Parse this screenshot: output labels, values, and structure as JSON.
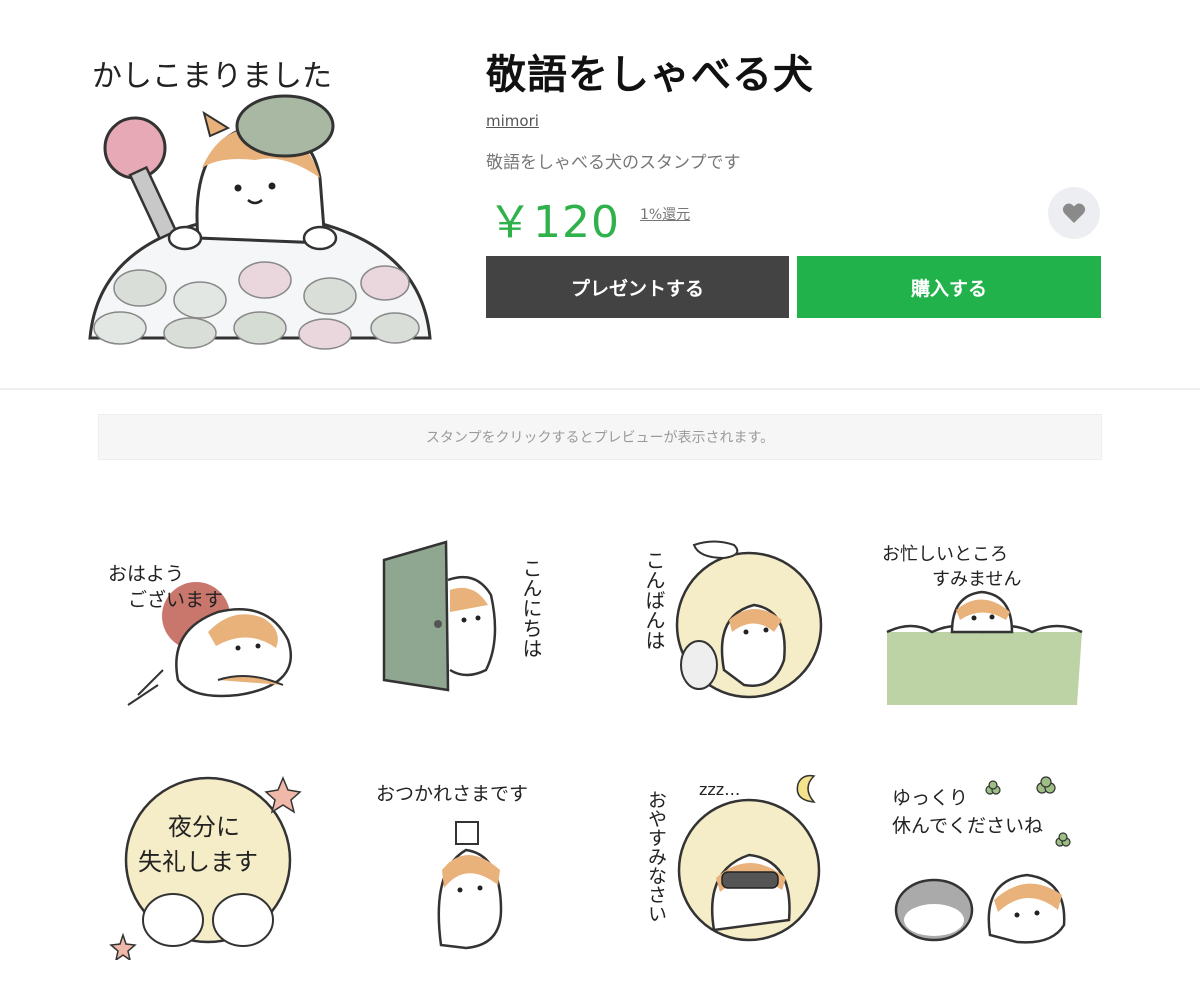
{
  "product": {
    "title": "敬語をしゃべる犬",
    "author": "mimori",
    "description": "敬語をしゃべる犬のスタンプです",
    "price": "￥120",
    "cashback": "1%還元",
    "favorite_icon": "heart-icon",
    "main_sticker_text": "かしこまりました"
  },
  "actions": {
    "gift_label": "プレゼントする",
    "buy_label": "購入する"
  },
  "notice": "スタンプをクリックするとプレビューが表示されます。",
  "stickers": [
    {
      "text": [
        "おはよう",
        "ございます"
      ]
    },
    {
      "text": [
        "こんにちは"
      ]
    },
    {
      "text": [
        "こんばんは"
      ]
    },
    {
      "text": [
        "お忙しいところ",
        "すみません"
      ]
    },
    {
      "text": [
        "夜分に",
        "失礼します"
      ]
    },
    {
      "text": [
        "おつかれさまです"
      ]
    },
    {
      "text": [
        "おやすみなさい",
        "zzz…"
      ]
    },
    {
      "text": [
        "ゆっくり",
        "休んでくださいね"
      ]
    }
  ],
  "colors": {
    "accent_green": "#22b24c",
    "price_green": "#2fb14b",
    "gift_button": "#434343",
    "dog_orange": "#e9b27a"
  }
}
